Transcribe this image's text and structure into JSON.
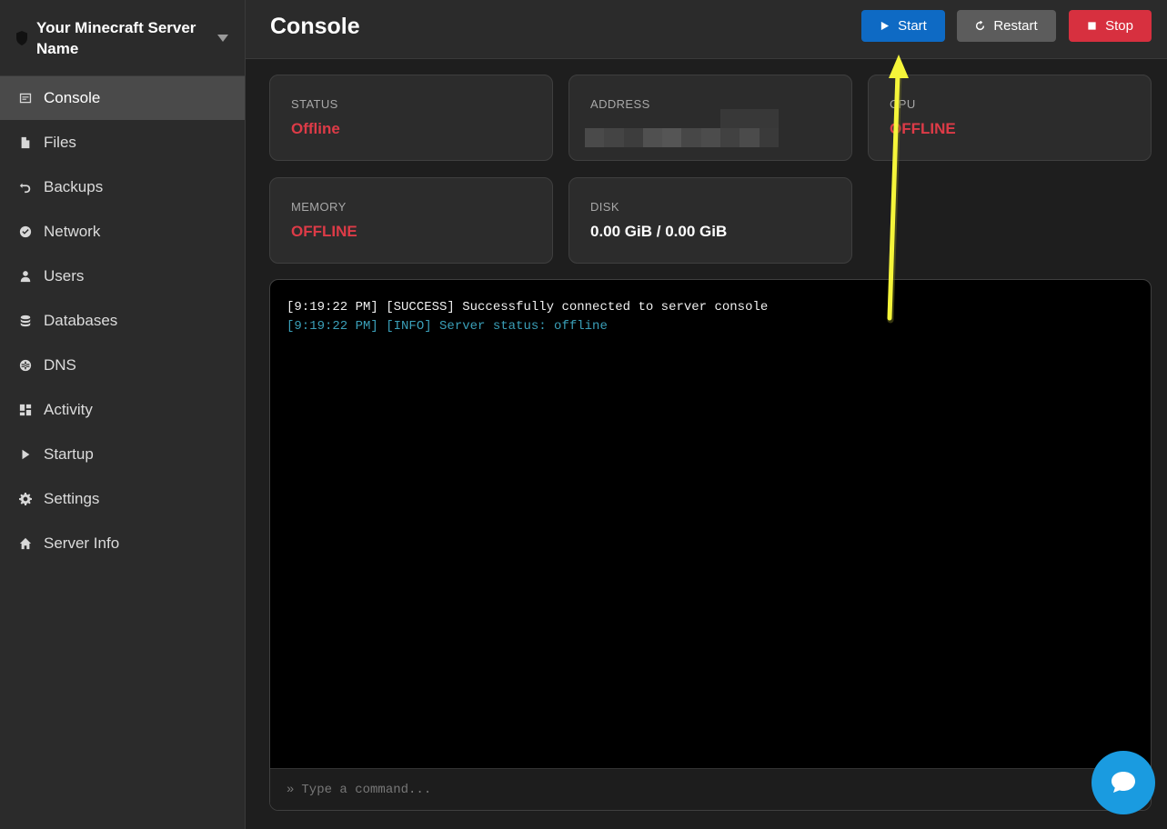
{
  "sidebar": {
    "server_name": "Your Minecraft Server Name",
    "items": [
      {
        "label": "Console",
        "icon": "console-icon",
        "active": true
      },
      {
        "label": "Files",
        "icon": "file-icon"
      },
      {
        "label": "Backups",
        "icon": "backup-icon"
      },
      {
        "label": "Network",
        "icon": "network-icon"
      },
      {
        "label": "Users",
        "icon": "user-icon"
      },
      {
        "label": "Databases",
        "icon": "database-icon"
      },
      {
        "label": "DNS",
        "icon": "globe-icon"
      },
      {
        "label": "Activity",
        "icon": "activity-icon"
      },
      {
        "label": "Startup",
        "icon": "play-icon"
      },
      {
        "label": "Settings",
        "icon": "gear-icon"
      },
      {
        "label": "Server Info",
        "icon": "home-icon"
      }
    ]
  },
  "header": {
    "title": "Console",
    "start_label": "Start",
    "restart_label": "Restart",
    "stop_label": "Stop"
  },
  "stats": {
    "status_label": "STATUS",
    "status_value": "Offline",
    "address_label": "ADDRESS",
    "cpu_label": "CPU",
    "cpu_value": "OFFLINE",
    "memory_label": "MEMORY",
    "memory_value": "OFFLINE",
    "disk_label": "DISK",
    "disk_value": "0.00 GiB / 0.00 GiB"
  },
  "console": {
    "lines": [
      {
        "text": "[9:19:22 PM] [SUCCESS] Successfully connected to server console",
        "level": "success"
      },
      {
        "text": "[9:19:22 PM] [INFO] Server status: offline",
        "level": "info"
      }
    ],
    "prompt": "»",
    "placeholder": "Type a command..."
  },
  "colors": {
    "accent_blue": "#0e6ac4",
    "danger_red": "#d7303f",
    "offline_red": "#dd3b47",
    "annotation_arrow": "#f5f53a"
  }
}
